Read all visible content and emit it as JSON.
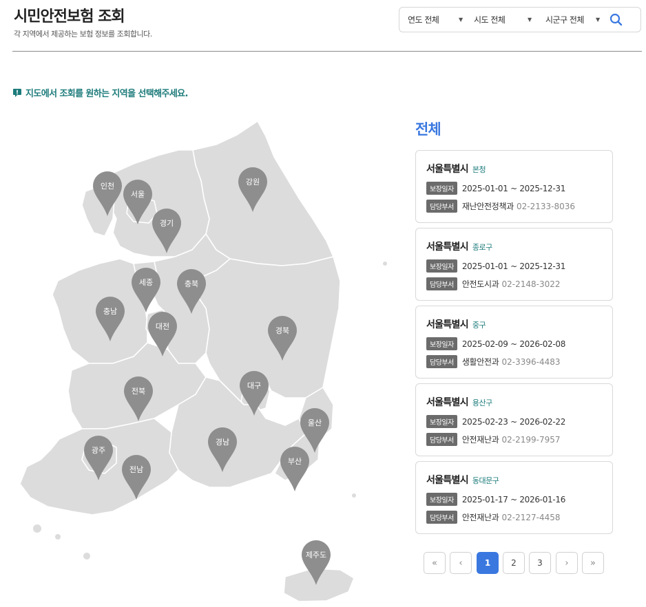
{
  "header": {
    "title": "시민안전보험 조회",
    "subtitle": "각 지역에서 제공하는 보험 정보를 조회합니다."
  },
  "filters": {
    "year": "연도 전체",
    "province": "시도 전체",
    "district": "시군구 전체",
    "search_icon": "search-icon"
  },
  "notice": {
    "icon": "exclamation-speech-icon",
    "text": "지도에서 조회를 원하는 지역을 선택해주세요."
  },
  "map": {
    "pins": [
      "인천",
      "서울",
      "경기",
      "강원",
      "세종",
      "충북",
      "충남",
      "대전",
      "경북",
      "대구",
      "전북",
      "울산",
      "광주",
      "경남",
      "부산",
      "전남",
      "제주도"
    ]
  },
  "panel": {
    "title": "전체",
    "coverage_badge": "보장일자",
    "dept_badge": "담당부서",
    "cards": [
      {
        "city": "서울특별시",
        "district": "본청",
        "period": "2025-01-01 ~ 2025-12-31",
        "dept": "재난안전정책과",
        "phone": "02-2133-8036"
      },
      {
        "city": "서울특별시",
        "district": "종로구",
        "period": "2025-01-01 ~ 2025-12-31",
        "dept": "안전도시과",
        "phone": "02-2148-3022"
      },
      {
        "city": "서울특별시",
        "district": "중구",
        "period": "2025-02-09 ~ 2026-02-08",
        "dept": "생활안전과",
        "phone": "02-3396-4483"
      },
      {
        "city": "서울특별시",
        "district": "용산구",
        "period": "2025-02-23 ~ 2026-02-22",
        "dept": "안전재난과",
        "phone": "02-2199-7957"
      },
      {
        "city": "서울특별시",
        "district": "동대문구",
        "period": "2025-01-17 ~ 2026-01-16",
        "dept": "안전재난과",
        "phone": "02-2127-4458"
      }
    ]
  },
  "pagination": {
    "first": "«",
    "prev": "‹",
    "pages": [
      "1",
      "2",
      "3"
    ],
    "current": "1",
    "next": "›",
    "last": "»"
  },
  "colors": {
    "accent": "#3a78e0",
    "teal": "#1d7b7b",
    "pin": "#8e8e8e",
    "map_fill": "#dcdcdc"
  }
}
